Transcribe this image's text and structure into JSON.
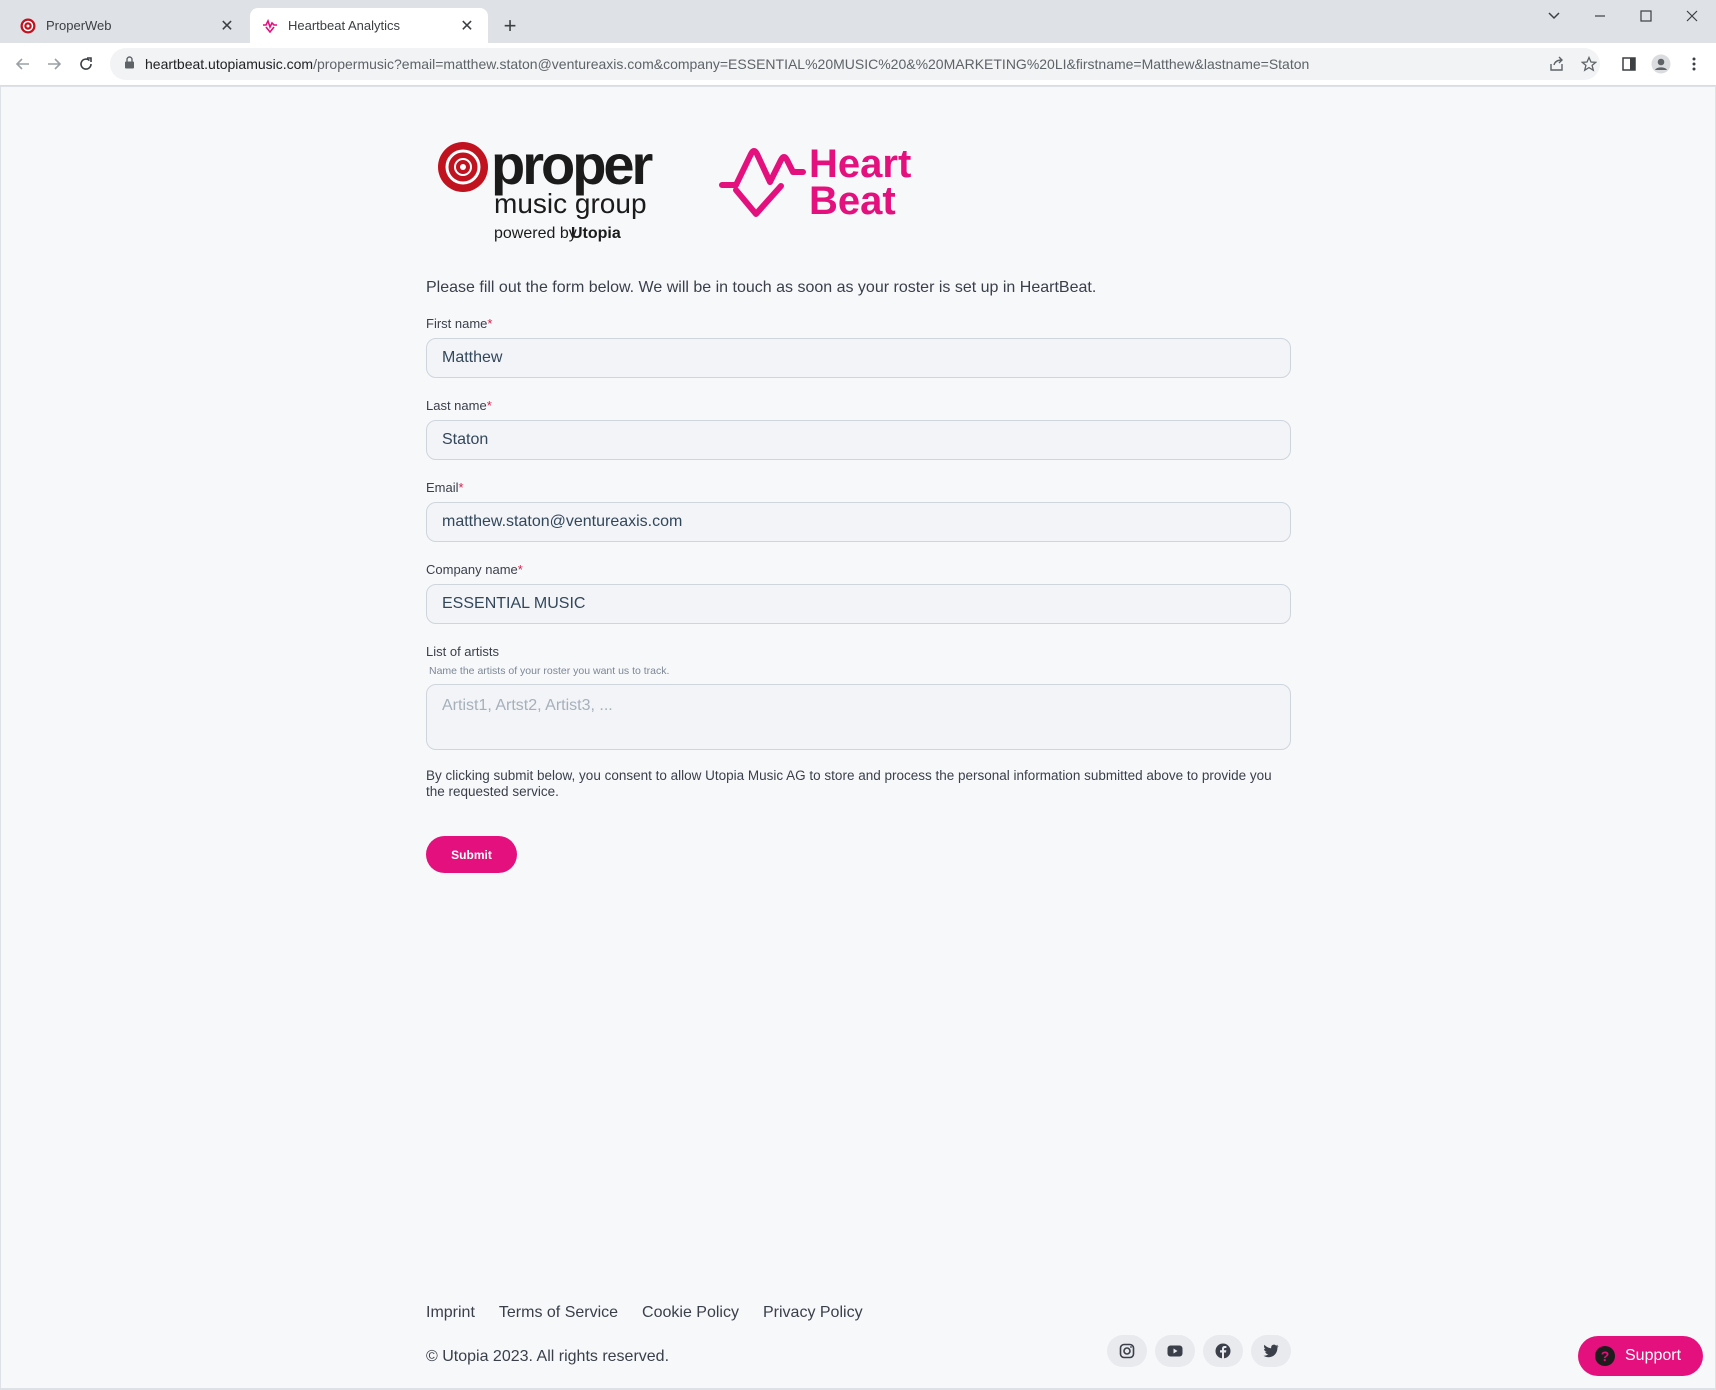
{
  "browser": {
    "tabs": [
      {
        "title": "ProperWeb",
        "icon": "properweb-favicon"
      },
      {
        "title": "Heartbeat Analytics",
        "icon": "heartbeat-favicon"
      }
    ],
    "url_host": "heartbeat.utopiamusic.com",
    "url_path": "/propermusic?email=matthew.staton@ventureaxis.com&company=ESSENTIAL%20MUSIC%20&%20MARKETING%20LI&firstname=Matthew&lastname=Staton"
  },
  "brand": {
    "proper_word": "proper",
    "proper_sub": "music group",
    "powered_prefix": "powered by",
    "powered_name": "Utopia",
    "heartbeat_line1": "Heart",
    "heartbeat_line2": "Beat",
    "accent_color": "#e4107d",
    "proper_red": "#c1121f"
  },
  "form": {
    "intro": "Please fill out the form below. We will be in touch as soon as your roster is set up in HeartBeat.",
    "first_name": {
      "label": "First name",
      "required": "*",
      "value": "Matthew"
    },
    "last_name": {
      "label": "Last name",
      "required": "*",
      "value": "Staton"
    },
    "email": {
      "label": "Email",
      "required": "*",
      "value": "matthew.staton@ventureaxis.com"
    },
    "company": {
      "label": "Company name",
      "required": "*",
      "value": "ESSENTIAL MUSIC"
    },
    "artists": {
      "label": "List of artists",
      "helper": "Name the artists of your roster you want us to track.",
      "placeholder": "Artist1, Artst2, Artist3, ..."
    },
    "consent": "By clicking submit below, you consent to allow Utopia Music AG to store and process the personal information submitted above to provide you the requested service.",
    "submit_label": "Submit"
  },
  "footer": {
    "links": [
      "Imprint",
      "Terms of Service",
      "Cookie Policy",
      "Privacy Policy"
    ],
    "copyright": "© Utopia 2023. All rights reserved.",
    "social": [
      "instagram-icon",
      "youtube-icon",
      "facebook-icon",
      "twitter-icon"
    ]
  },
  "support": {
    "label": "Support"
  }
}
